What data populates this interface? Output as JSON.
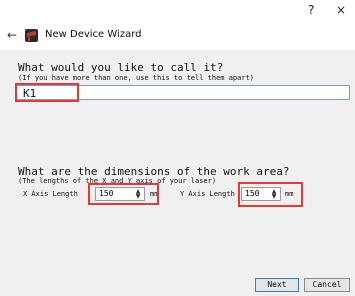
{
  "titlebar": {
    "help": "?",
    "close": "×"
  },
  "header": {
    "back": "←",
    "title": "New Device Wizard"
  },
  "name_section": {
    "question": "What would you like to call it?",
    "hint": "(If you have more than one, use this to tell them apart)",
    "value": "K1"
  },
  "dimensions": {
    "question": "What are the dimensions of the work area?",
    "hint": "(The lengths of the X and Y axis of your laser)",
    "x_label": "X Axis Length",
    "x_value": "150",
    "x_unit": "mm",
    "y_label": "Y Axis Length",
    "y_value": "150",
    "y_unit": "mm"
  },
  "buttons": {
    "next": "Next",
    "cancel": "Cancel"
  },
  "colors": {
    "highlight": "#e53935",
    "accent": "#3c78d8",
    "icon": "#c0392b"
  }
}
